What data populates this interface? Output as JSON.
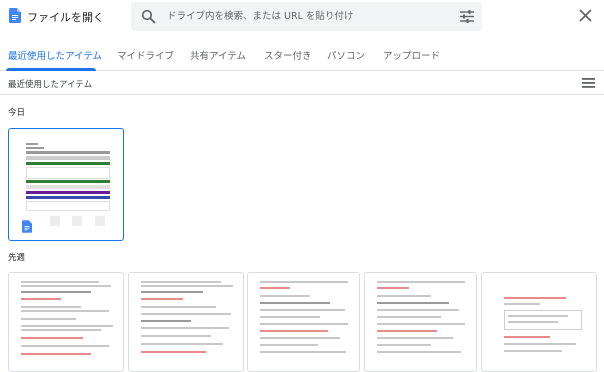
{
  "header": {
    "title": "ファイルを開く",
    "search_placeholder": "ドライブ内を検索、または URL を貼り付け"
  },
  "tabs": [
    {
      "label": "最近使用したアイテム",
      "active": true
    },
    {
      "label": "マイドライブ",
      "active": false
    },
    {
      "label": "共有アイテム",
      "active": false
    },
    {
      "label": "スター付き",
      "active": false
    },
    {
      "label": "パソコン",
      "active": false
    },
    {
      "label": "アップロード",
      "active": false
    }
  ],
  "section": {
    "title": "最近使用したアイテム"
  },
  "groups": {
    "today": "今日",
    "last_week": "先週"
  },
  "icons": {
    "app": "docs-icon",
    "search": "search-icon",
    "tune": "tune-icon",
    "close": "close-icon",
    "view": "list-view-icon"
  },
  "colors": {
    "accent": "#1a73e8",
    "docs_blue": "#4285f4"
  }
}
